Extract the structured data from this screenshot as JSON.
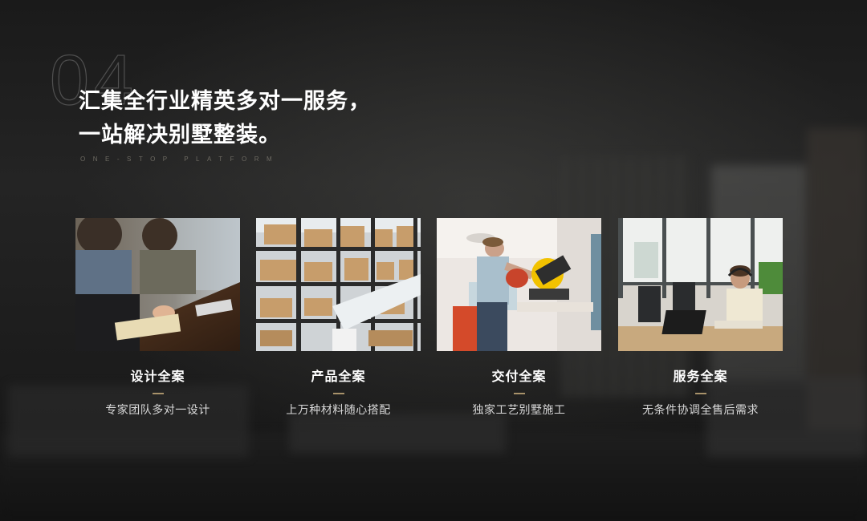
{
  "section": {
    "number": "04",
    "headline_line1": "汇集全行业精英多对一服务，",
    "headline_line2": "一站解决别墅整装。",
    "subtitle": "ONE-STOP PLATFORM"
  },
  "cards": [
    {
      "title": "设计全案",
      "desc": "专家团队多对一设计",
      "photo": "design-team-meeting-photo"
    },
    {
      "title": "产品全案",
      "desc": "上万种材料随心搭配",
      "photo": "warehouse-shelves-photo"
    },
    {
      "title": "交付全案",
      "desc": "独家工艺别墅施工",
      "photo": "worker-miter-saw-photo"
    },
    {
      "title": "服务全案",
      "desc": "无条件协调全售后需求",
      "photo": "customer-service-agent-photo"
    }
  ],
  "colors": {
    "background": "#1c1c1c",
    "accent": "#a8926a",
    "title": "#ffffff",
    "desc": "#d8d8d8"
  }
}
